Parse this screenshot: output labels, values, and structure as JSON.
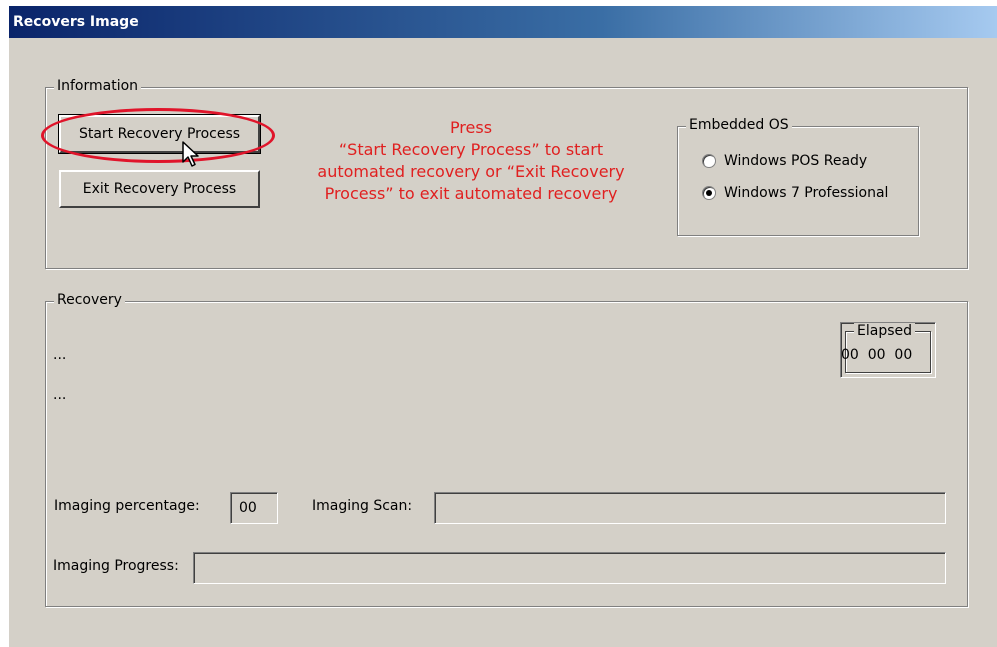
{
  "window": {
    "title": "Recovers Image"
  },
  "information": {
    "legend": "Information",
    "start_button": "Start Recovery Process",
    "exit_button": "Exit Recovery Process",
    "instruction_lines": [
      "Press",
      "“Start Recovery Process” to start",
      "automated recovery or “Exit Recovery",
      "Process” to exit automated recovery"
    ],
    "instruction_color": "#e02020",
    "highlight_color": "#e0142a"
  },
  "embedded_os": {
    "legend": "Embedded OS",
    "options": [
      {
        "label": "Windows POS Ready",
        "checked": false
      },
      {
        "label": "Windows 7 Professional",
        "checked": true
      }
    ]
  },
  "recovery": {
    "legend": "Recovery",
    "status_line_1": "...",
    "status_line_2": "...",
    "elapsed": {
      "legend": "Elapsed",
      "value": "00  00  00"
    },
    "imaging_percentage_label": "Imaging percentage:",
    "imaging_percentage_value": "00",
    "imaging_scan_label": "Imaging Scan:",
    "imaging_scan_value": "",
    "imaging_progress_label": "Imaging Progress:",
    "imaging_progress_value": ""
  }
}
